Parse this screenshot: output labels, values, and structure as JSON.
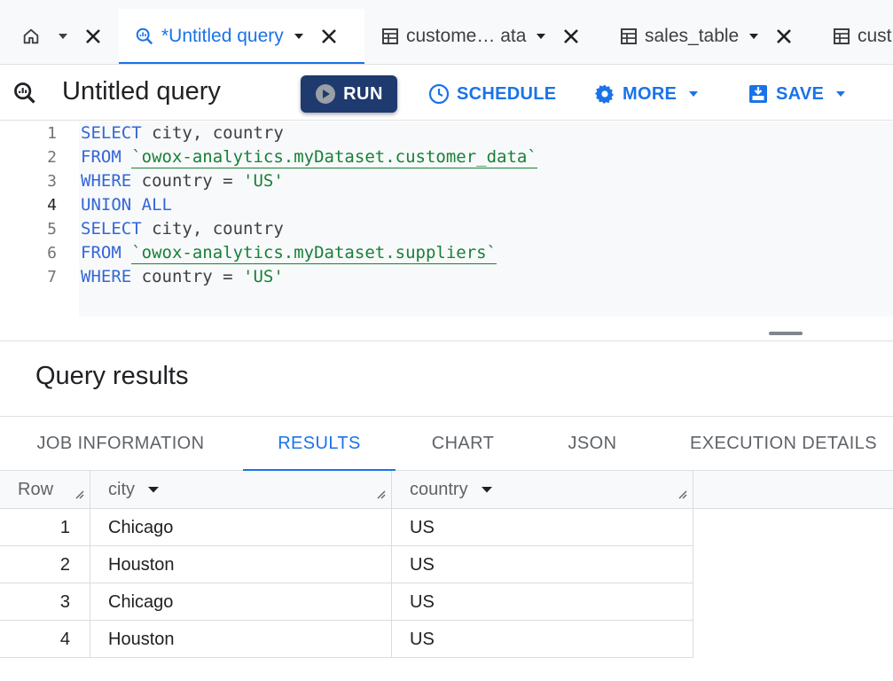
{
  "tabs": [
    {
      "id": "home",
      "label": ""
    },
    {
      "id": "untitled",
      "label": "*Untitled query",
      "active": true
    },
    {
      "id": "customer",
      "label": "custome… ata"
    },
    {
      "id": "sales",
      "label": "sales_table"
    },
    {
      "id": "cust2",
      "label": "cust"
    }
  ],
  "toolbar": {
    "title": "Untitled query",
    "run_label": "RUN",
    "schedule_label": "SCHEDULE",
    "more_label": "MORE",
    "save_label": "SAVE"
  },
  "editor": {
    "current_line": 4,
    "lines": [
      {
        "n": "1"
      },
      {
        "n": "2"
      },
      {
        "n": "3"
      },
      {
        "n": "4"
      },
      {
        "n": "5"
      },
      {
        "n": "6"
      },
      {
        "n": "7"
      }
    ],
    "kw_select": "SELECT",
    "kw_from": "FROM",
    "kw_where": "WHERE",
    "kw_union": "UNION ALL",
    "cols": " city, country",
    "table_1": "`owox-analytics.myDataset.customer_data`",
    "table_2": "`owox-analytics.myDataset.suppliers`",
    "cond": " country = ",
    "literal": "'US'"
  },
  "results": {
    "title": "Query results",
    "tabs": {
      "job": "JOB INFORMATION",
      "results": "RESULTS",
      "chart": "CHART",
      "json": "JSON",
      "exec": "EXECUTION DETAILS"
    },
    "active_tab": "RESULTS",
    "columns": {
      "row": "Row",
      "city": "city",
      "country": "country"
    },
    "rows": [
      {
        "row": "1",
        "city": "Chicago",
        "country": "US"
      },
      {
        "row": "2",
        "city": "Houston",
        "country": "US"
      },
      {
        "row": "3",
        "city": "Chicago",
        "country": "US"
      },
      {
        "row": "4",
        "city": "Houston",
        "country": "US"
      }
    ]
  },
  "colors": {
    "accent": "#1a73e8",
    "run_button": "#1e3a6e",
    "keyword": "#3367d6",
    "string": "#188038"
  },
  "icons": {
    "home": "home-icon",
    "query": "query-icon",
    "table": "table-icon",
    "run": "play-icon",
    "schedule": "clock-icon",
    "more": "gear-icon",
    "save": "save-icon"
  }
}
